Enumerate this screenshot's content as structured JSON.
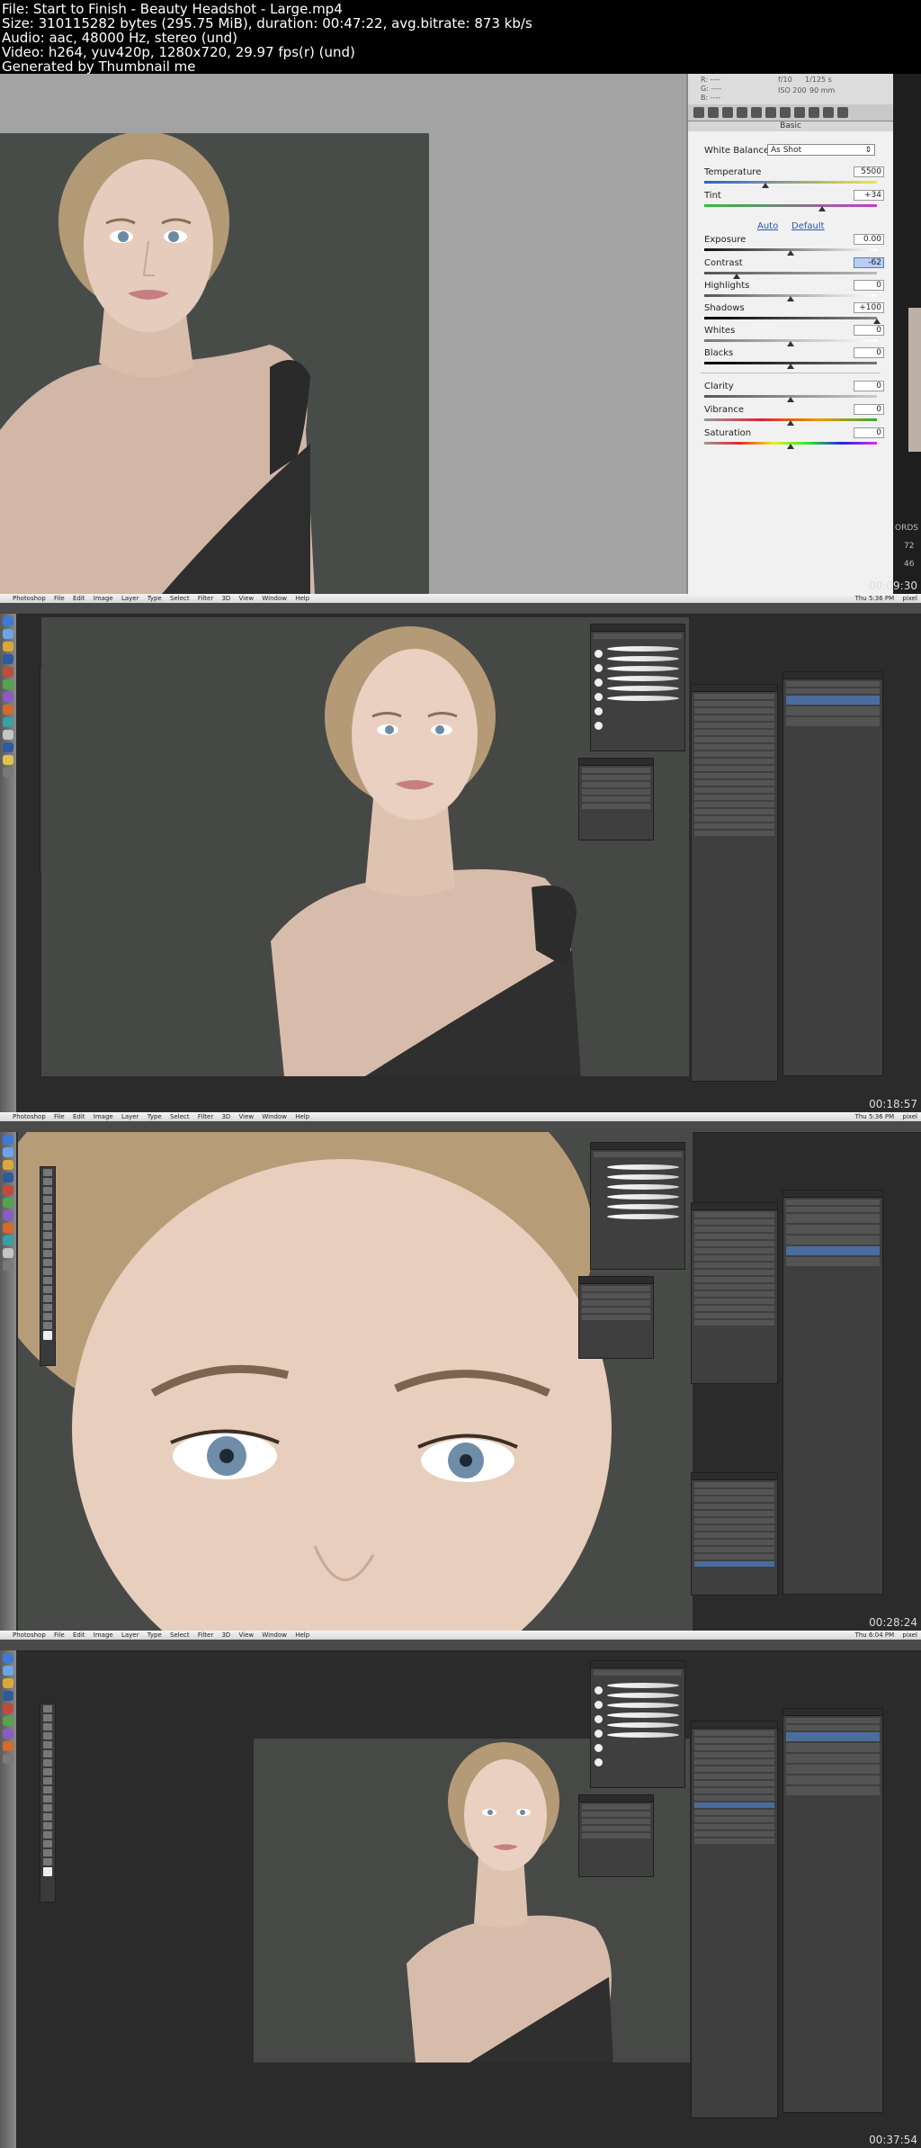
{
  "header": {
    "line1": "File: Start to Finish - Beauty Headshot - Large.mp4",
    "line2": "Size: 310115282 bytes (295.75 MiB), duration: 00:47:22, avg.bitrate: 873 kb/s",
    "line3": "Audio: aac, 48000 Hz, stereo (und)",
    "line4": "Video: h264, yuv420p, 1280x720, 29.97 fps(r) (und)",
    "line5": "Generated by Thumbnail me"
  },
  "frames": {
    "f1": {
      "timestamp": "00:09:30"
    },
    "f2": {
      "timestamp": "00:18:57"
    },
    "f3": {
      "timestamp": "00:28:24"
    },
    "f4": {
      "timestamp": "00:37:54"
    }
  },
  "menubar": {
    "app": "Photoshop",
    "items": [
      "File",
      "Edit",
      "Image",
      "Layer",
      "Type",
      "Select",
      "Filter",
      "3D",
      "View",
      "Window",
      "Help"
    ],
    "clock_f2": "Thu 5:36 PM",
    "clock_f3": "Thu 5:36 PM",
    "clock_f4": "Thu 6:04 PM",
    "user": "pixel"
  },
  "camera_raw": {
    "readout": {
      "r": "R: ----",
      "g": "G: ----",
      "b": "B: ----",
      "aperture": "f/10",
      "shutter": "1/125 s",
      "iso": "ISO 200",
      "focal": "90 mm"
    },
    "section": "Basic",
    "white_balance_label": "White Balance:",
    "white_balance_value": "As Shot",
    "temperature": {
      "label": "Temperature",
      "value": "5500"
    },
    "tint": {
      "label": "Tint",
      "value": "+34"
    },
    "auto_link": "Auto",
    "default_link": "Default",
    "exposure": {
      "label": "Exposure",
      "value": "0.00"
    },
    "contrast": {
      "label": "Contrast",
      "value": "-62"
    },
    "highlights": {
      "label": "Highlights",
      "value": "0"
    },
    "shadows": {
      "label": "Shadows",
      "value": "+100"
    },
    "whites": {
      "label": "Whites",
      "value": "0"
    },
    "blacks": {
      "label": "Blacks",
      "value": "0"
    },
    "clarity": {
      "label": "Clarity",
      "value": "0"
    },
    "vibrance": {
      "label": "Vibrance",
      "value": "0"
    },
    "saturation": {
      "label": "Saturation",
      "value": "0"
    },
    "edge_text_1": "ORDS",
    "edge_text_2": "72",
    "edge_text_3": "46"
  },
  "colors": {
    "accent": "#2a56b0",
    "cr_panel": "#f1f1f1",
    "ps_bg": "#2e2e2e"
  }
}
